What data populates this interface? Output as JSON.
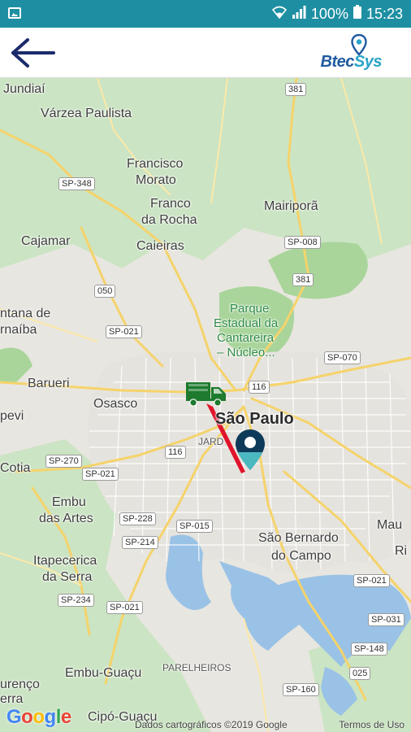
{
  "status_bar": {
    "battery": "100%",
    "time": "15:23"
  },
  "app_bar": {
    "logo_part1": "Btec",
    "logo_part2": "Sys"
  },
  "map": {
    "labels": {
      "jundiai": "Jundiaí",
      "varzea": "Várzea Paulista",
      "francisco1": "Francisco",
      "francisco2": "Morato",
      "franco1": "Franco",
      "franco2": "da Rocha",
      "mairipora": "Mairiporã",
      "cajamar": "Cajamar",
      "caieiras": "Caieiras",
      "parque1": "Parque",
      "parque2": "Estadual da",
      "parque3": "Cantareira",
      "parque4": "– Núcleo...",
      "santana1": "ntana de",
      "santana2": "rnaíba",
      "barueri": "Barueri",
      "osasco": "Osasco",
      "saopaulo": "São Paulo",
      "pevi": "pevi",
      "cotia": "Cotia",
      "jard": "JARD",
      "embu1": "Embu",
      "embu2": "das Artes",
      "sbc1": "São Bernardo",
      "sbc2": "do Campo",
      "maua": "Mau",
      "rib": "Ri",
      "itapecerica1": "Itapecerica",
      "itapecerica2": "da Serra",
      "embuguacu": "Embu-Guaçu",
      "parelheiros": "PARELHEIROS",
      "lourenco1": "urenço",
      "lourenco2": "erra",
      "cipo": "Cipó-Guaçu"
    },
    "shields": {
      "r381a": "381",
      "sp348": "SP-348",
      "sp008": "SP-008",
      "r381b": "381",
      "r050": "050",
      "sp021a": "SP-021",
      "sp070": "SP-070",
      "r116a": "116",
      "r116b": "116",
      "sp270": "SP-270",
      "sp021b": "SP-021",
      "sp228": "SP-228",
      "sp015": "SP-015",
      "sp214": "SP-214",
      "sp021c": "SP-021",
      "sp234": "SP-234",
      "sp021d": "SP-021",
      "sp031": "SP-031",
      "sp148": "SP-148",
      "r025": "025",
      "sp160": "SP-160"
    },
    "google": {
      "g1": "G",
      "o1": "o",
      "o2": "o",
      "g2": "g",
      "l": "l",
      "e": "e"
    },
    "attribution": "Dados cartográficos ©2019 Google",
    "terms": "Termos de Uso"
  },
  "colors": {
    "status_bar": "#1e8fa3",
    "route": "#e0142a",
    "truck": "#1d7a2e",
    "pin_dark": "#0e3a5a",
    "pin_light": "#4cb8bf",
    "back_arrow": "#1b2b6b"
  }
}
